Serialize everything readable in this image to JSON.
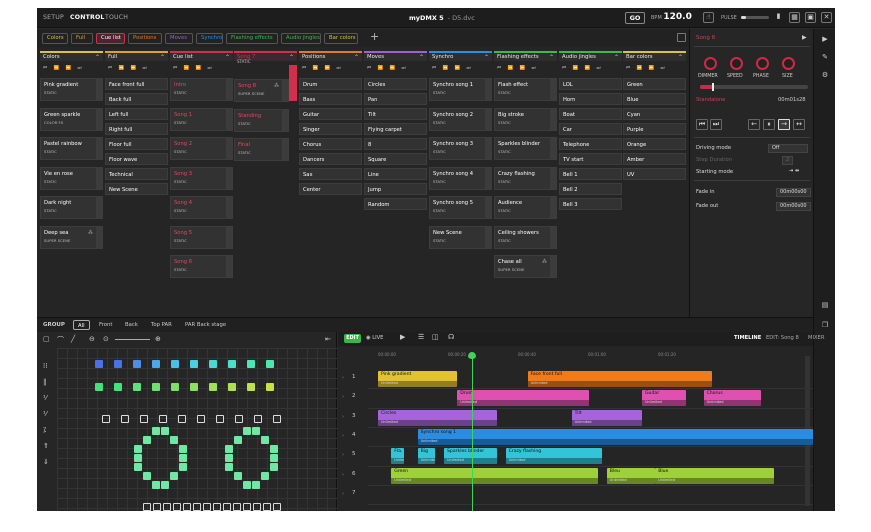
{
  "top": {
    "menu": [
      "SETUP",
      "CONTROL",
      "TOUCH"
    ],
    "app_title": "myDMX 5",
    "file_name": "- D5.dvc",
    "go": "GO",
    "bpm_label": "BPM",
    "bpm_value": "120.0",
    "pulse_label": "PULSE"
  },
  "tabs": [
    {
      "label": "Colors",
      "color": "#d8c24a"
    },
    {
      "label": "Full",
      "color": "#e3a028"
    },
    {
      "label": "Cue list",
      "color": "#d0304c",
      "selected": true
    },
    {
      "label": "Positions",
      "color": "#e07a2a"
    },
    {
      "label": "Moves",
      "color": "#a060d0"
    },
    {
      "label": "Synchro",
      "color": "#2b8ee0"
    },
    {
      "label": "Flashing effects",
      "color": "#3fb84c"
    },
    {
      "label": "Audio jingles",
      "color": "#3fb84c"
    },
    {
      "label": "Bar colors",
      "color": "#d8c24a"
    }
  ],
  "columns": [
    {
      "name": "Colors",
      "color": "#d8c24a",
      "cells": [
        {
          "name": "Pink gradient",
          "sub": "STATIC"
        },
        {
          "name": "Green sparkle",
          "sub": "COLOR FX"
        },
        {
          "name": "Pastel rainbow",
          "sub": "STATIC"
        },
        {
          "name": "Vie en rose",
          "sub": "STATIC"
        },
        {
          "name": "Dark night",
          "sub": "STATIC"
        },
        {
          "name": "Deep sea",
          "sub": "SUPER SCENE"
        }
      ]
    },
    {
      "name": "Full",
      "color": "#e3a028",
      "cells": [
        {
          "name": "Face front full"
        },
        {
          "name": "Back full"
        },
        {
          "name": "Left full"
        },
        {
          "name": "Right full"
        },
        {
          "name": "Floor full"
        },
        {
          "name": "Floor wave"
        },
        {
          "name": "Technical"
        },
        {
          "name": "New Scene"
        }
      ]
    },
    {
      "name": "Cue list",
      "color": "#d0304c",
      "cells": [
        {
          "name": "Intro",
          "sub": "STATIC"
        },
        {
          "name": "Song 1",
          "sub": "STATIC"
        },
        {
          "name": "Song 2",
          "sub": "STATIC"
        },
        {
          "name": "Song 3",
          "sub": "STATIC"
        },
        {
          "name": "Song 4",
          "sub": "STATIC"
        },
        {
          "name": "Song 5",
          "sub": "STATIC"
        },
        {
          "name": "Song 6",
          "sub": "STATIC"
        }
      ]
    },
    {
      "name": "Song 7",
      "color": "#d0304c",
      "sub_head": "STATIC",
      "cells": [
        {
          "name": "Song 8",
          "sub": "SUPER SCENE"
        },
        {
          "name": "Standing",
          "sub": "STATIC"
        },
        {
          "name": "Final",
          "sub": "STATIC"
        }
      ]
    },
    {
      "name": "Positions",
      "color": "#e07a2a",
      "cells": [
        {
          "name": "Drum"
        },
        {
          "name": "Bass"
        },
        {
          "name": "Guitar"
        },
        {
          "name": "Singer"
        },
        {
          "name": "Chorus"
        },
        {
          "name": "Dancers"
        },
        {
          "name": "Sax"
        },
        {
          "name": "Center"
        }
      ]
    },
    {
      "name": "Moves",
      "color": "#a060d0",
      "cells": [
        {
          "name": "Circles"
        },
        {
          "name": "Pan"
        },
        {
          "name": "Tilt"
        },
        {
          "name": "Flying carpet"
        },
        {
          "name": "8"
        },
        {
          "name": "Square"
        },
        {
          "name": "Line"
        },
        {
          "name": "Jump"
        },
        {
          "name": "Random"
        }
      ]
    },
    {
      "name": "Synchro",
      "color": "#2b8ee0",
      "cells": [
        {
          "name": "Synchro song 1",
          "sub": "STATIC"
        },
        {
          "name": "Synchro song 2",
          "sub": "STATIC"
        },
        {
          "name": "Synchro song 3",
          "sub": "STATIC"
        },
        {
          "name": "Synchro song 4",
          "sub": "STATIC"
        },
        {
          "name": "Synchro song 5",
          "sub": "STATIC"
        },
        {
          "name": "New Scene",
          "sub": "STATIC"
        }
      ]
    },
    {
      "name": "Flashing effects",
      "color": "#3fb84c",
      "cells": [
        {
          "name": "Flash effect",
          "sub": "STATIC"
        },
        {
          "name": "Big stroke",
          "sub": "STATIC"
        },
        {
          "name": "Sparkles blinder",
          "sub": "STATIC"
        },
        {
          "name": "Crazy flashing",
          "sub": "STATIC"
        },
        {
          "name": "Audience",
          "sub": "STATIC"
        },
        {
          "name": "Ceiling showers",
          "sub": "STATIC"
        },
        {
          "name": "Chase all",
          "sub": "SUPER SCENE"
        }
      ]
    },
    {
      "name": "Audio jingles",
      "color": "#3fb84c",
      "cells": [
        {
          "name": "LOL"
        },
        {
          "name": "Horn"
        },
        {
          "name": "Boat"
        },
        {
          "name": "Car"
        },
        {
          "name": "Telephone"
        },
        {
          "name": "TV start"
        },
        {
          "name": "Bell 1"
        },
        {
          "name": "Bell 2"
        },
        {
          "name": "Bell 3"
        }
      ]
    },
    {
      "name": "Bar colors",
      "color": "#d8c24a",
      "cells": [
        {
          "name": "Green"
        },
        {
          "name": "Blue"
        },
        {
          "name": "Cyan"
        },
        {
          "name": "Purple"
        },
        {
          "name": "Orange"
        },
        {
          "name": "Amber"
        },
        {
          "name": "UV"
        }
      ]
    }
  ],
  "side": {
    "title": "Song 8",
    "knobs": [
      "DIMMER",
      "SPEED",
      "PHASE",
      "SIZE"
    ],
    "section": "Standalone",
    "time": "00m01s28",
    "driving_mode_label": "Driving mode",
    "driving_mode_value": "Off",
    "step_duration_label": "Step Duration",
    "step_duration_value": "2",
    "starting_mode_label": "Starting mode",
    "fade_in_label": "Fade in",
    "fade_in_value": "00m00s00",
    "fade_out_label": "Fade out",
    "fade_out_value": "00m00s00"
  },
  "group": {
    "label": "GROUP",
    "buttons": [
      "All",
      "Front",
      "Back",
      "Top PAR",
      "PAR Back stage"
    ]
  },
  "timeline": {
    "edit": "EDIT",
    "live": "LIVE",
    "tabs": [
      "TIMELINE",
      "EDIT: Song 8",
      "MIXER"
    ],
    "ruler": [
      "00:00:00",
      "00:00:20",
      "00:00:40",
      "00:01:00",
      "00:01:20"
    ],
    "tracks": [
      "1",
      "2",
      "3",
      "4",
      "5",
      "6",
      "7"
    ],
    "clips": [
      {
        "track": 1,
        "name": "Pink gradient",
        "sub": "Unlimited",
        "color": "#e3c232",
        "start": 0.0,
        "end": 0.18
      },
      {
        "track": 1,
        "name": "Face front full",
        "sub": "Unlimited",
        "color": "#f07b18",
        "start": 0.34,
        "end": 0.76
      },
      {
        "track": 2,
        "name": "Drum",
        "sub": "Unlimited",
        "color": "#e050b0",
        "start": 0.18,
        "end": 0.48
      },
      {
        "track": 2,
        "name": "Guitar",
        "sub": "Unlimited",
        "color": "#e050b0",
        "start": 0.6,
        "end": 0.7
      },
      {
        "track": 2,
        "name": "Chorus",
        "sub": "Unlimited",
        "color": "#e050b0",
        "start": 0.74,
        "end": 0.87
      },
      {
        "track": 3,
        "name": "Circles",
        "sub": "Unlimited",
        "color": "#a764d8",
        "start": 0.0,
        "end": 0.27
      },
      {
        "track": 3,
        "name": "Tilt",
        "sub": "Unlimited",
        "color": "#a764d8",
        "start": 0.44,
        "end": 0.6
      },
      {
        "track": 4,
        "name": "Synchro song 1",
        "sub": "Unlimited",
        "color": "#2a8de2",
        "start": 0.09,
        "end": 1.0
      },
      {
        "track": 5,
        "name": "Fla.",
        "sub": "Unlimited",
        "color": "#33c4d8",
        "start": 0.03,
        "end": 0.06
      },
      {
        "track": 5,
        "name": "Big",
        "sub": "Unlimited",
        "color": "#33c4d8",
        "start": 0.09,
        "end": 0.13
      },
      {
        "track": 5,
        "name": "Sparkles blinder",
        "sub": "Unlimited",
        "color": "#33c4d8",
        "start": 0.15,
        "end": 0.27
      },
      {
        "track": 5,
        "name": "Crazy flashing",
        "sub": "Unlimited",
        "color": "#33c4d8",
        "start": 0.29,
        "end": 0.51
      },
      {
        "track": 6,
        "name": "Green",
        "sub": "Unlimited",
        "color": "#9ed03a",
        "start": 0.03,
        "end": 0.5
      },
      {
        "track": 6,
        "name": "Bleu",
        "sub": "Unlimited",
        "color": "#9ed03a",
        "start": 0.52,
        "end": 0.63
      },
      {
        "track": 6,
        "name": "Blue",
        "sub": "Unlimited",
        "color": "#9ed03a",
        "start": 0.63,
        "end": 0.9
      }
    ]
  }
}
